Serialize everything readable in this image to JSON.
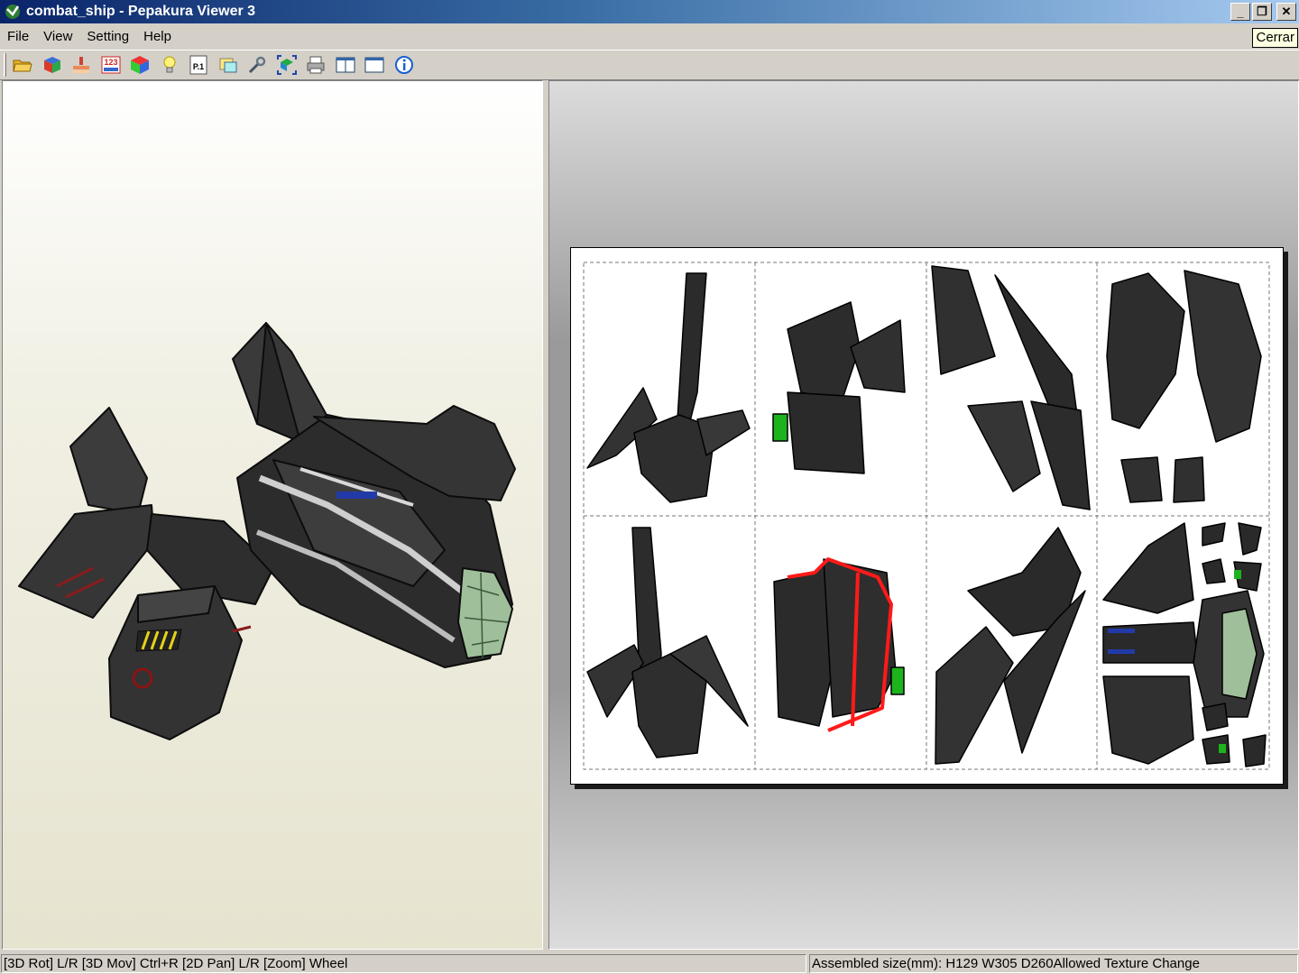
{
  "window": {
    "title": "combat_ship - Pepakura Viewer 3",
    "minimize_label": "_",
    "restore_label": "❐",
    "close_label": "✕",
    "tooltip": "Cerrar"
  },
  "menu": [
    "File",
    "View",
    "Setting",
    "Help"
  ],
  "toolbar": {
    "icons": [
      "open-folder-icon",
      "3d-cube-icon",
      "flatten-icon",
      "numbering-icon",
      "texture-cube-icon",
      "lightbulb-icon",
      "page-number-icon",
      "layout-icon",
      "tool-wrench-icon",
      "fit-view-icon",
      "print-icon",
      "single-view-icon",
      "split-view-icon",
      "info-icon"
    ],
    "page_label": "P.1",
    "number_label": "123"
  },
  "status": {
    "left": "[3D Rot] L/R [3D Mov] Ctrl+R [2D Pan] L/R [Zoom] Wheel",
    "right": "Assembled size(mm): H129 W305 D260Allowed Texture Change"
  },
  "colors": {
    "title_start": "#0a246a",
    "title_end": "#a6caf0",
    "chrome": "#d4d0c8",
    "tooltip_bg": "#ffffe1",
    "cut_line_highlight": "#ff1a1a",
    "cockpit_green": "#9fbf9a"
  }
}
